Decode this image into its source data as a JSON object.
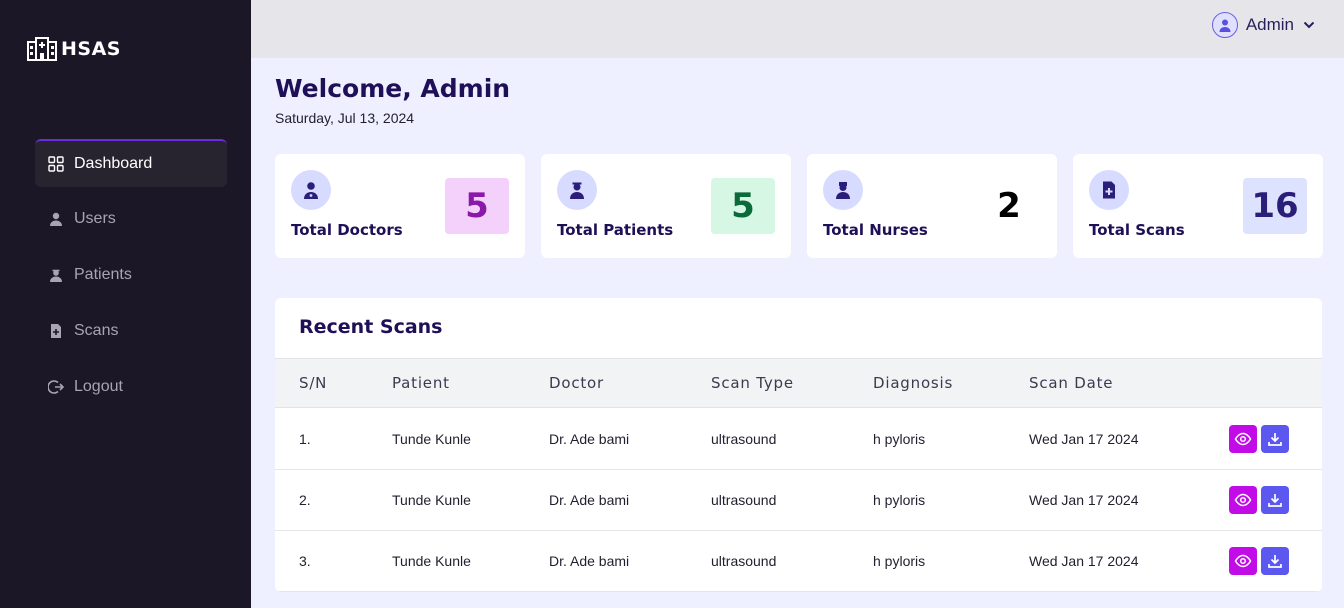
{
  "app": {
    "name": "HSAS"
  },
  "sidebar": {
    "items": [
      {
        "label": "Dashboard",
        "icon": "grid-icon"
      },
      {
        "label": "Users",
        "icon": "user-icon"
      },
      {
        "label": "Patients",
        "icon": "patient-icon"
      },
      {
        "label": "Scans",
        "icon": "file-plus-icon"
      },
      {
        "label": "Logout",
        "icon": "logout-icon"
      }
    ]
  },
  "header": {
    "user": "Admin",
    "icon": "user-circle-icon"
  },
  "main": {
    "welcome": "Welcome, Admin",
    "date": "Saturday, Jul 13, 2024"
  },
  "stats": [
    {
      "label": "Total Doctors",
      "value": "5",
      "icon": "doctor-icon",
      "color": "#8a18a8",
      "bg": "#f3d1fb"
    },
    {
      "label": "Total Patients",
      "value": "5",
      "icon": "patient-icon",
      "color": "#0b6a3a",
      "bg": "#d6f7e3"
    },
    {
      "label": "Total Nurses",
      "value": "2",
      "icon": "nurse-icon",
      "color": "#000000",
      "bg": "#ffffff"
    },
    {
      "label": "Total Scans",
      "value": "16",
      "icon": "file-plus-icon",
      "color": "#2b1d7a",
      "bg": "#dde2ff"
    }
  ],
  "recent_scans": {
    "title": "Recent Scans",
    "columns": [
      "S/N",
      "Patient",
      "Doctor",
      "Scan Type",
      "Diagnosis",
      "Scan Date"
    ],
    "rows": [
      {
        "sn": "1.",
        "patient": "Tunde Kunle",
        "doctor": "Dr. Ade bami",
        "type": "ultrasound",
        "diagnosis": "h pyloris",
        "date": "Wed Jan 17 2024"
      },
      {
        "sn": "2.",
        "patient": "Tunde Kunle",
        "doctor": "Dr. Ade bami",
        "type": "ultrasound",
        "diagnosis": "h pyloris",
        "date": "Wed Jan 17 2024"
      },
      {
        "sn": "3.",
        "patient": "Tunde Kunle",
        "doctor": "Dr. Ade bami",
        "type": "ultrasound",
        "diagnosis": "h pyloris",
        "date": "Wed Jan 17 2024"
      }
    ]
  },
  "colors": {
    "sidebar_bg": "#1b1727",
    "accent": "#6a2bd9",
    "view_button": "#c20ce8",
    "download_button": "#5b57ef"
  }
}
